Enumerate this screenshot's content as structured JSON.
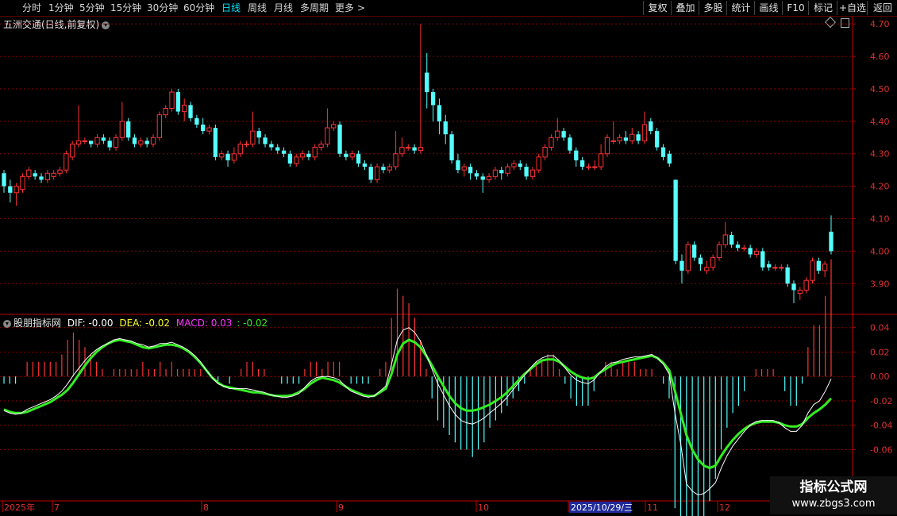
{
  "toolbar": {
    "periods": [
      "分时",
      "1分钟",
      "5分钟",
      "15分钟",
      "30分钟",
      "60分钟",
      "日线",
      "周线",
      "月线",
      "多周期",
      "更多 >"
    ],
    "active_period": "日线",
    "right_buttons": [
      "复权",
      "叠加",
      "多股",
      "统计",
      "画线",
      "F10",
      "标记",
      "+自选",
      "返回"
    ]
  },
  "stock_title": "五洲交通(日线,前复权)",
  "indicator": {
    "name": "股朋指标网",
    "dif_label": "DIF: -0.00",
    "dea_label": "DEA: -0.02",
    "macd_label": "MACD: 0.03",
    "extra_label": ": -0.02"
  },
  "watermark": {
    "line1": "指标公式网",
    "line2": "www.zbgs3.com"
  },
  "colors": {
    "up": "#ff3333",
    "down": "#54ffff",
    "dif": "#ffffff",
    "dea": "#33ee22",
    "axis": "#c00000",
    "grid": "#8b0000"
  },
  "chart_data": [
    {
      "type": "candlestick",
      "price_ticks": [
        "4.70",
        "4.60",
        "4.50",
        "4.40",
        "4.30",
        "4.20",
        "4.10",
        "4.00",
        "3.90"
      ],
      "ylim": [
        3.82,
        4.72
      ],
      "date_labels": [
        "2025年",
        "7",
        "8",
        "9",
        "10",
        "2025/10/29/三",
        "11",
        "12"
      ],
      "candles": [
        [
          4.24,
          4.2,
          4.25,
          4.18
        ],
        [
          4.2,
          4.18,
          4.22,
          4.15
        ],
        [
          4.18,
          4.2,
          4.21,
          4.14
        ],
        [
          4.19,
          4.23,
          4.24,
          4.18
        ],
        [
          4.23,
          4.25,
          4.26,
          4.22
        ],
        [
          4.24,
          4.23,
          4.25,
          4.22
        ],
        [
          4.23,
          4.22,
          4.24,
          4.21
        ],
        [
          4.22,
          4.24,
          4.25,
          4.21
        ],
        [
          4.23,
          4.24,
          4.25,
          4.22
        ],
        [
          4.24,
          4.25,
          4.26,
          4.23
        ],
        [
          4.25,
          4.3,
          4.31,
          4.24
        ],
        [
          4.29,
          4.33,
          4.34,
          4.28
        ],
        [
          4.33,
          4.34,
          4.45,
          4.32
        ],
        [
          4.34,
          4.34,
          4.35,
          4.33
        ],
        [
          4.34,
          4.33,
          4.34,
          4.32
        ],
        [
          4.33,
          4.35,
          4.36,
          4.32
        ],
        [
          4.35,
          4.34,
          4.36,
          4.33
        ],
        [
          4.34,
          4.32,
          4.35,
          4.31
        ],
        [
          4.32,
          4.35,
          4.36,
          4.31
        ],
        [
          4.35,
          4.4,
          4.46,
          4.34
        ],
        [
          4.4,
          4.35,
          4.41,
          4.34
        ],
        [
          4.35,
          4.33,
          4.36,
          4.32
        ],
        [
          4.33,
          4.34,
          4.35,
          4.32
        ],
        [
          4.34,
          4.33,
          4.35,
          4.32
        ],
        [
          4.33,
          4.35,
          4.36,
          4.32
        ],
        [
          4.35,
          4.42,
          4.43,
          4.34
        ],
        [
          4.42,
          4.44,
          4.45,
          4.41
        ],
        [
          4.44,
          4.49,
          4.5,
          4.43
        ],
        [
          4.49,
          4.43,
          4.5,
          4.42
        ],
        [
          4.43,
          4.45,
          4.47,
          4.4
        ],
        [
          4.45,
          4.41,
          4.46,
          4.4
        ],
        [
          4.41,
          4.39,
          4.42,
          4.38
        ],
        [
          4.39,
          4.37,
          4.41,
          4.36
        ],
        [
          4.37,
          4.38,
          4.39,
          4.36
        ],
        [
          4.38,
          4.29,
          4.39,
          4.28
        ],
        [
          4.29,
          4.3,
          4.31,
          4.28
        ],
        [
          4.3,
          4.28,
          4.31,
          4.26
        ],
        [
          4.28,
          4.3,
          4.32,
          4.27
        ],
        [
          4.3,
          4.33,
          4.34,
          4.29
        ],
        [
          4.33,
          4.33,
          4.34,
          4.32
        ],
        [
          4.33,
          4.37,
          4.43,
          4.32
        ],
        [
          4.37,
          4.35,
          4.38,
          4.33
        ],
        [
          4.35,
          4.33,
          4.36,
          4.32
        ],
        [
          4.33,
          4.32,
          4.34,
          4.31
        ],
        [
          4.32,
          4.31,
          4.33,
          4.3
        ],
        [
          4.31,
          4.3,
          4.32,
          4.29
        ],
        [
          4.3,
          4.27,
          4.31,
          4.26
        ],
        [
          4.27,
          4.29,
          4.3,
          4.26
        ],
        [
          4.29,
          4.3,
          4.31,
          4.28
        ],
        [
          4.3,
          4.29,
          4.31,
          4.28
        ],
        [
          4.29,
          4.32,
          4.33,
          4.28
        ],
        [
          4.32,
          4.33,
          4.34,
          4.31
        ],
        [
          4.33,
          4.38,
          4.44,
          4.32
        ],
        [
          4.38,
          4.39,
          4.4,
          4.37
        ],
        [
          4.39,
          4.3,
          4.4,
          4.29
        ],
        [
          4.3,
          4.29,
          4.31,
          4.28
        ],
        [
          4.29,
          4.3,
          4.31,
          4.28
        ],
        [
          4.3,
          4.27,
          4.31,
          4.26
        ],
        [
          4.27,
          4.26,
          4.28,
          4.25
        ],
        [
          4.26,
          4.22,
          4.27,
          4.21
        ],
        [
          4.22,
          4.26,
          4.27,
          4.21
        ],
        [
          4.26,
          4.25,
          4.27,
          4.24
        ],
        [
          4.25,
          4.26,
          4.27,
          4.24
        ],
        [
          4.26,
          4.3,
          4.37,
          4.25
        ],
        [
          4.3,
          4.32,
          4.35,
          4.29
        ],
        [
          4.32,
          4.32,
          4.33,
          4.31
        ],
        [
          4.32,
          4.31,
          4.33,
          4.3
        ],
        [
          4.31,
          4.32,
          4.7,
          4.3
        ],
        [
          4.55,
          4.49,
          4.61,
          4.44
        ],
        [
          4.49,
          4.45,
          4.5,
          4.4
        ],
        [
          4.45,
          4.4,
          4.47,
          4.36
        ],
        [
          4.4,
          4.36,
          4.42,
          4.33
        ],
        [
          4.36,
          4.28,
          4.37,
          4.27
        ],
        [
          4.28,
          4.25,
          4.3,
          4.24
        ],
        [
          4.25,
          4.26,
          4.27,
          4.23
        ],
        [
          4.26,
          4.24,
          4.27,
          4.22
        ],
        [
          4.24,
          4.23,
          4.25,
          4.22
        ],
        [
          4.23,
          4.22,
          4.24,
          4.18
        ],
        [
          4.22,
          4.23,
          4.24,
          4.21
        ],
        [
          4.23,
          4.25,
          4.26,
          4.22
        ],
        [
          4.25,
          4.24,
          4.26,
          4.22
        ],
        [
          4.24,
          4.26,
          4.27,
          4.23
        ],
        [
          4.26,
          4.27,
          4.28,
          4.25
        ],
        [
          4.27,
          4.26,
          4.28,
          4.25
        ],
        [
          4.26,
          4.23,
          4.27,
          4.22
        ],
        [
          4.23,
          4.25,
          4.26,
          4.22
        ],
        [
          4.25,
          4.29,
          4.3,
          4.24
        ],
        [
          4.29,
          4.32,
          4.33,
          4.28
        ],
        [
          4.32,
          4.35,
          4.36,
          4.31
        ],
        [
          4.35,
          4.37,
          4.41,
          4.34
        ],
        [
          4.37,
          4.35,
          4.38,
          4.34
        ],
        [
          4.35,
          4.31,
          4.36,
          4.3
        ],
        [
          4.31,
          4.28,
          4.32,
          4.26
        ],
        [
          4.28,
          4.26,
          4.29,
          4.25
        ],
        [
          4.26,
          4.26,
          4.27,
          4.25
        ],
        [
          4.26,
          4.26,
          4.28,
          4.25
        ],
        [
          4.26,
          4.3,
          4.33,
          4.25
        ],
        [
          4.3,
          4.35,
          4.36,
          4.29
        ],
        [
          4.34,
          4.34,
          4.4,
          4.33
        ],
        [
          4.34,
          4.35,
          4.36,
          4.33
        ],
        [
          4.35,
          4.34,
          4.37,
          4.33
        ],
        [
          4.34,
          4.36,
          4.38,
          4.33
        ],
        [
          4.36,
          4.34,
          4.37,
          4.33
        ],
        [
          4.34,
          4.39,
          4.43,
          4.33
        ],
        [
          4.4,
          4.37,
          4.41,
          4.36
        ],
        [
          4.37,
          4.32,
          4.38,
          4.31
        ],
        [
          4.32,
          4.29,
          4.33,
          4.28
        ],
        [
          4.3,
          4.27,
          4.31,
          4.26
        ],
        [
          4.22,
          3.97,
          4.22,
          3.96
        ],
        [
          3.97,
          3.94,
          3.99,
          3.9
        ],
        [
          3.94,
          4.02,
          4.03,
          3.93
        ],
        [
          4.02,
          3.98,
          4.03,
          3.97
        ],
        [
          3.98,
          3.96,
          3.99,
          3.94
        ],
        [
          3.94,
          3.95,
          3.97,
          3.93
        ],
        [
          3.95,
          3.98,
          3.99,
          3.94
        ],
        [
          3.98,
          4.02,
          4.03,
          3.97
        ],
        [
          4.02,
          4.05,
          4.09,
          4.01
        ],
        [
          4.05,
          4.02,
          4.06,
          4.01
        ],
        [
          4.02,
          4.01,
          4.03,
          4.0
        ],
        [
          4.01,
          4.01,
          4.02,
          4.0
        ],
        [
          4.01,
          3.99,
          4.02,
          3.98
        ],
        [
          3.99,
          4.0,
          4.01,
          3.98
        ],
        [
          4.0,
          3.95,
          4.01,
          3.94
        ],
        [
          3.96,
          3.95,
          3.97,
          3.94
        ],
        [
          3.95,
          3.95,
          3.96,
          3.94
        ],
        [
          3.95,
          3.95,
          3.96,
          3.94
        ],
        [
          3.95,
          3.9,
          3.96,
          3.89
        ],
        [
          3.9,
          3.88,
          3.91,
          3.84
        ],
        [
          3.87,
          3.88,
          3.89,
          3.85
        ],
        [
          3.88,
          3.91,
          3.92,
          3.87
        ],
        [
          3.91,
          3.97,
          3.98,
          3.9
        ],
        [
          3.97,
          3.94,
          3.98,
          3.93
        ],
        [
          3.94,
          3.96,
          3.97,
          3.92
        ],
        [
          4.06,
          4.0,
          4.11,
          3.99
        ]
      ]
    },
    {
      "type": "macd",
      "y_ticks": [
        "0.04",
        "0.02",
        "0.00",
        "-0.02",
        "-0.04",
        "-0.06"
      ],
      "ylim": [
        -0.1,
        0.045
      ],
      "dif": [
        -0.028,
        -0.03,
        -0.031,
        -0.03,
        -0.027,
        -0.025,
        -0.023,
        -0.021,
        -0.019,
        -0.016,
        -0.012,
        -0.006,
        0.001,
        0.007,
        0.013,
        0.018,
        0.022,
        0.025,
        0.027,
        0.03,
        0.031,
        0.03,
        0.029,
        0.027,
        0.026,
        0.024,
        0.025,
        0.027,
        0.027,
        0.028,
        0.026,
        0.024,
        0.021,
        0.017,
        0.012,
        0.005,
        -0.001,
        -0.006,
        -0.008,
        -0.01,
        -0.01,
        -0.01,
        -0.01,
        -0.011,
        -0.012,
        -0.013,
        -0.015,
        -0.016,
        -0.017,
        -0.017,
        -0.016,
        -0.014,
        -0.009,
        -0.004,
        -0.001,
        0.0,
        0.0,
        -0.001,
        -0.003,
        -0.008,
        -0.012,
        -0.014,
        -0.016,
        -0.017,
        -0.016,
        -0.012,
        -0.008,
        0.01,
        0.03,
        0.038,
        0.04,
        0.036,
        0.029,
        0.018,
        0.006,
        -0.006,
        -0.015,
        -0.024,
        -0.031,
        -0.036,
        -0.038,
        -0.039,
        -0.037,
        -0.034,
        -0.03,
        -0.026,
        -0.022,
        -0.017,
        -0.011,
        -0.005,
        0.001,
        0.007,
        0.012,
        0.015,
        0.017,
        0.017,
        0.013,
        0.007,
        0.001,
        -0.003,
        -0.005,
        -0.006,
        -0.003,
        0.003,
        0.008,
        0.011,
        0.012,
        0.014,
        0.015,
        0.016,
        0.016,
        0.017,
        0.018,
        0.015,
        0.01,
        0.002,
        -0.03,
        -0.055,
        -0.088,
        -0.094,
        -0.097,
        -0.096,
        -0.092,
        -0.087,
        -0.075,
        -0.065,
        -0.057,
        -0.051,
        -0.045,
        -0.04,
        -0.037,
        -0.036,
        -0.036,
        -0.036,
        -0.038,
        -0.042,
        -0.045,
        -0.045,
        -0.04,
        -0.03,
        -0.023,
        -0.02,
        -0.012,
        -0.002
      ],
      "dea": [
        -0.027,
        -0.029,
        -0.03,
        -0.03,
        -0.029,
        -0.027,
        -0.025,
        -0.023,
        -0.021,
        -0.018,
        -0.015,
        -0.011,
        -0.005,
        0.002,
        0.009,
        0.015,
        0.02,
        0.024,
        0.027,
        0.029,
        0.03,
        0.029,
        0.028,
        0.026,
        0.024,
        0.023,
        0.024,
        0.025,
        0.026,
        0.026,
        0.025,
        0.023,
        0.02,
        0.016,
        0.011,
        0.005,
        -0.001,
        -0.005,
        -0.008,
        -0.009,
        -0.01,
        -0.011,
        -0.012,
        -0.013,
        -0.013,
        -0.014,
        -0.015,
        -0.016,
        -0.016,
        -0.016,
        -0.015,
        -0.013,
        -0.01,
        -0.006,
        -0.003,
        -0.001,
        -0.002,
        -0.003,
        -0.005,
        -0.008,
        -0.011,
        -0.013,
        -0.015,
        -0.016,
        -0.016,
        -0.013,
        -0.01,
        0.002,
        0.018,
        0.027,
        0.03,
        0.028,
        0.024,
        0.017,
        0.009,
        0.0,
        -0.008,
        -0.016,
        -0.022,
        -0.026,
        -0.028,
        -0.028,
        -0.027,
        -0.025,
        -0.023,
        -0.02,
        -0.017,
        -0.013,
        -0.008,
        -0.003,
        0.002,
        0.006,
        0.01,
        0.013,
        0.014,
        0.014,
        0.012,
        0.008,
        0.004,
        0.001,
        -0.001,
        -0.002,
        -0.001,
        0.003,
        0.006,
        0.009,
        0.011,
        0.012,
        0.013,
        0.014,
        0.015,
        0.016,
        0.017,
        0.015,
        0.011,
        0.005,
        -0.012,
        -0.03,
        -0.048,
        -0.06,
        -0.068,
        -0.073,
        -0.075,
        -0.073,
        -0.065,
        -0.058,
        -0.052,
        -0.047,
        -0.043,
        -0.04,
        -0.038,
        -0.037,
        -0.037,
        -0.037,
        -0.038,
        -0.04,
        -0.041,
        -0.041,
        -0.039,
        -0.034,
        -0.03,
        -0.027,
        -0.023,
        -0.018
      ]
    }
  ]
}
